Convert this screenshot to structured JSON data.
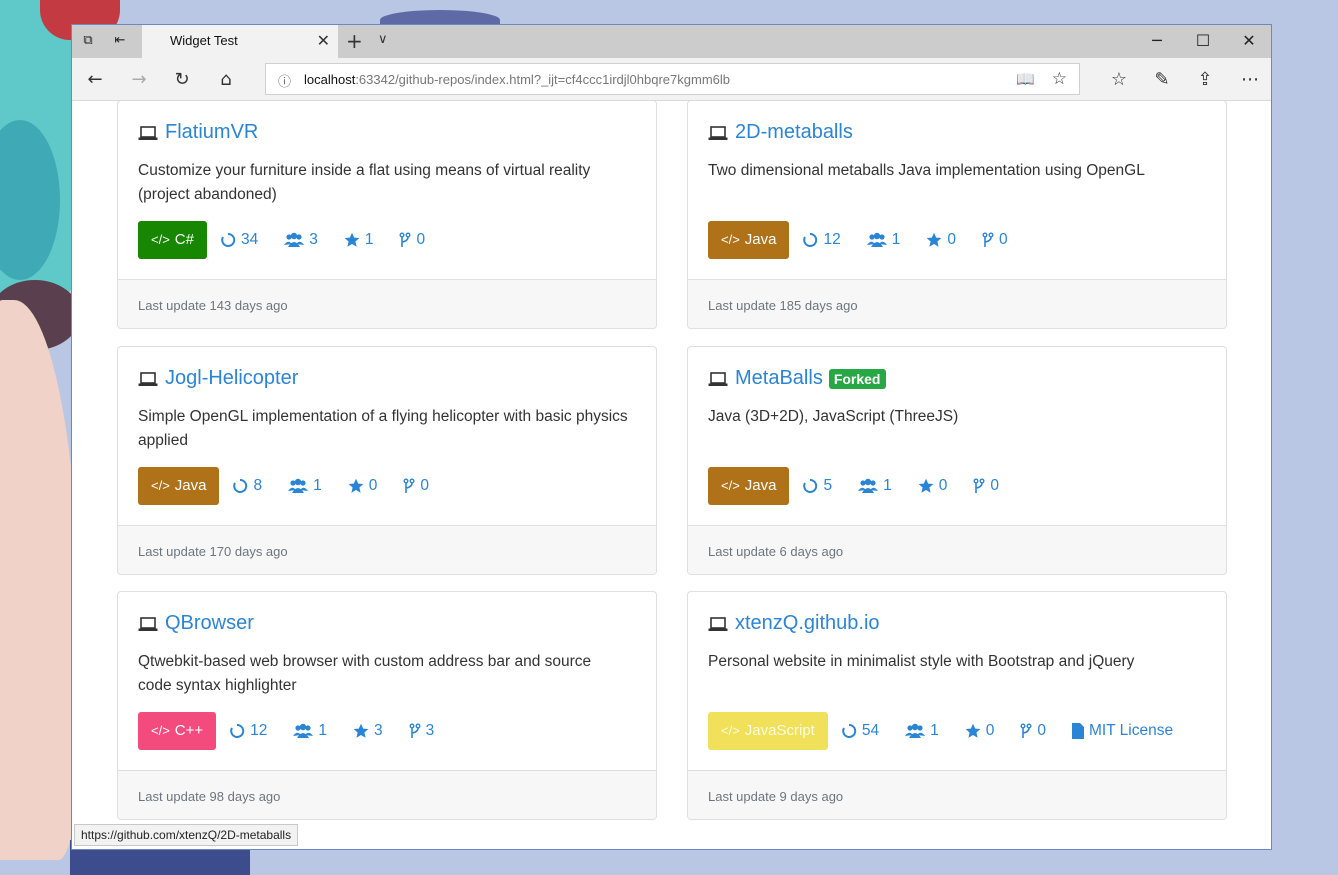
{
  "browser": {
    "tab_title": "Widget Test",
    "address_host": "localhost",
    "address_rest": ":63342/github-repos/index.html?_ijt=cf4ccc1irdjl0hbqre7kgmm6lb",
    "status_url": "https://github.com/xtenzQ/2D-metaballs"
  },
  "repos": [
    {
      "name": "FlatiumVR",
      "description": "Customize your furniture inside a flat using means of virtual reality (project abandoned)",
      "language": "C#",
      "language_color": "#178600",
      "size": "34",
      "contributors": "3",
      "stars": "1",
      "forks": "0",
      "updated": "Last update 143 days ago"
    },
    {
      "name": "2D-metaballs",
      "description": "Two dimensional metaballs Java implementation using OpenGL",
      "language": "Java",
      "language_color": "#b07219",
      "size": "12",
      "contributors": "1",
      "stars": "0",
      "forks": "0",
      "updated": "Last update 185 days ago"
    },
    {
      "name": "Jogl-Helicopter",
      "description": "Simple OpenGL implementation of a flying helicopter with basic physics applied",
      "language": "Java",
      "language_color": "#b07219",
      "size": "8",
      "contributors": "1",
      "stars": "0",
      "forks": "0",
      "updated": "Last update 170 days ago"
    },
    {
      "name": "MetaBalls",
      "badge": "Forked",
      "description": "Java (3D+2D), JavaScript (ThreeJS)",
      "language": "Java",
      "language_color": "#b07219",
      "size": "5",
      "contributors": "1",
      "stars": "0",
      "forks": "0",
      "updated": "Last update 6 days ago"
    },
    {
      "name": "QBrowser",
      "description": "Qtwebkit-based web browser with custom address bar and source code syntax highlighter",
      "language": "C++",
      "language_color": "#f34b7d",
      "size": "12",
      "contributors": "1",
      "stars": "3",
      "forks": "3",
      "updated": "Last update 98 days ago"
    },
    {
      "name": "xtenzQ.github.io",
      "description": "Personal website in minimalist style with Bootstrap and jQuery",
      "language": "JavaScript",
      "language_color": "#f1e05a",
      "size": "54",
      "contributors": "1",
      "stars": "0",
      "forks": "0",
      "license": "MIT License",
      "updated": "Last update 9 days ago"
    }
  ],
  "colors": {
    "link": "#2b85d6",
    "forked_badge": "#28a745",
    "accent_border": "#6e86c6"
  }
}
